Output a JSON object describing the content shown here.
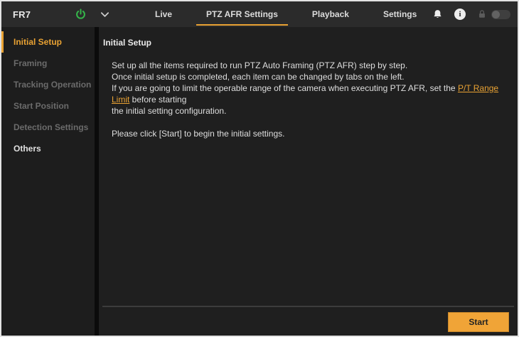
{
  "header": {
    "device_name": "FR7",
    "tabs": [
      {
        "label": "Live",
        "active": false
      },
      {
        "label": "PTZ AFR Settings",
        "active": true
      },
      {
        "label": "Playback",
        "active": false
      },
      {
        "label": "Settings",
        "active": false
      }
    ],
    "icons": [
      "power-icon",
      "chevron-down-icon",
      "bell-icon",
      "info-icon",
      "lock-icon",
      "lock-toggle"
    ],
    "info_glyph": "i"
  },
  "sidebar": {
    "items": [
      {
        "label": "Initial Setup",
        "state": "active"
      },
      {
        "label": "Framing",
        "state": "disabled"
      },
      {
        "label": "Tracking Operation",
        "state": "disabled"
      },
      {
        "label": "Start Position",
        "state": "disabled"
      },
      {
        "label": "Detection Settings",
        "state": "disabled"
      },
      {
        "label": "Others",
        "state": "enabled"
      }
    ]
  },
  "main": {
    "title": "Initial Setup",
    "intro_lines": [
      "Set up all the items required to run PTZ Auto Framing (PTZ AFR) step by step.",
      "Once initial setup is completed, each item can be changed by tabs on the left."
    ],
    "range_line": {
      "pre": "If you are going to limit the operable range of the camera when executing PTZ AFR, set the ",
      "link": "P/T Range Limit",
      "post": " before starting"
    },
    "range_line_cont": "the initial setting configuration.",
    "start_prompt": "Please click [Start] to begin the initial settings.",
    "start_button_label": "Start"
  },
  "colors": {
    "accent_orange": "#E9A233",
    "button_orange": "#F0A437",
    "power_green": "#35B54A",
    "header_bg": "#2B2B2B",
    "panel_bg": "#1E1E1E",
    "disabled_text": "#6B6B6B"
  }
}
